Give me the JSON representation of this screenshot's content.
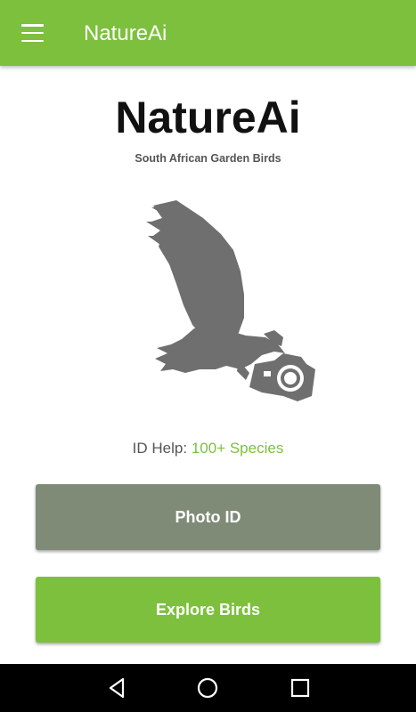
{
  "appbar": {
    "title": "NatureAi",
    "menu_icon": "menu-icon",
    "color": "#7dc03d"
  },
  "hero": {
    "title": "NatureAi",
    "subtitle": "South African Garden Birds",
    "illustration_icon": "eagle-with-camera-icon"
  },
  "id_help": {
    "label": "ID Help:",
    "value": "100+ Species"
  },
  "buttons": {
    "photo_id": "Photo ID",
    "explore_birds": "Explore Birds"
  },
  "navbar": {
    "back_icon": "back-triangle-icon",
    "home_icon": "home-circle-icon",
    "recents_icon": "recents-square-icon"
  },
  "colors": {
    "accent": "#7dc03d",
    "photo_button": "#7f8b77",
    "illustration": "#6f6f6f"
  }
}
